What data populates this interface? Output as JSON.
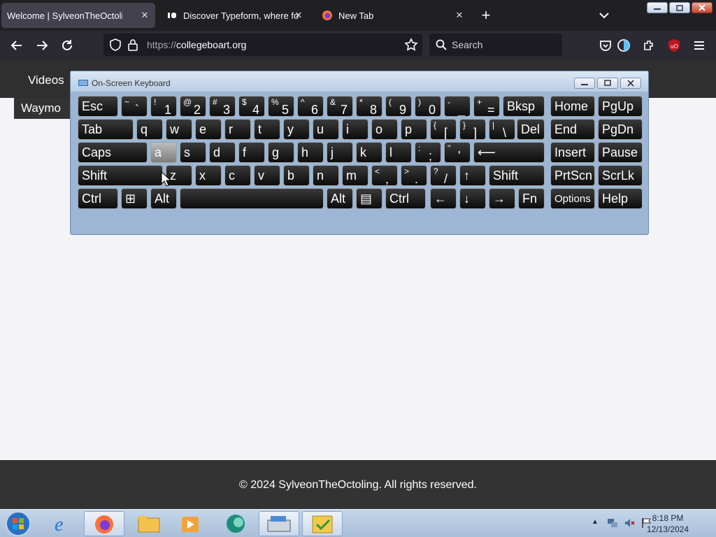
{
  "browser": {
    "tabs": [
      {
        "label": "Welcome | SylveonTheOctoling",
        "icon": "none",
        "active": true
      },
      {
        "label": "Discover Typeform, where form",
        "icon": "typeform-icon",
        "active": false
      },
      {
        "label": "New Tab",
        "icon": "firefox-icon",
        "active": false
      }
    ],
    "newtab_label": "+",
    "url_scheme": "https://",
    "url_host": "collegeboart.org",
    "search_placeholder": "Search"
  },
  "page": {
    "header_link": "Videos",
    "dropdown_item": "Waymo",
    "footer": "© 2024 SylveonTheOctoling. All rights reserved."
  },
  "osk": {
    "title": "On-Screen Keyboard",
    "pressed_key": "a",
    "rows": [
      [
        {
          "main": "Esc"
        },
        {
          "shift": "~",
          "base": "`"
        },
        {
          "shift": "!",
          "base": "1"
        },
        {
          "shift": "@",
          "base": "2"
        },
        {
          "shift": "#",
          "base": "3"
        },
        {
          "shift": "$",
          "base": "4"
        },
        {
          "shift": "%",
          "base": "5"
        },
        {
          "shift": "^",
          "base": "6"
        },
        {
          "shift": "&",
          "base": "7"
        },
        {
          "shift": "*",
          "base": "8"
        },
        {
          "shift": "(",
          "base": "9"
        },
        {
          "shift": ")",
          "base": "0"
        },
        {
          "shift": "-",
          "base": "_"
        },
        {
          "shift": "+",
          "base": "="
        },
        {
          "main": "Bksp"
        },
        {
          "main": "Home"
        },
        {
          "main": "PgUp"
        }
      ],
      [
        {
          "main": "Tab"
        },
        {
          "main": "q"
        },
        {
          "main": "w"
        },
        {
          "main": "e"
        },
        {
          "main": "r"
        },
        {
          "main": "t"
        },
        {
          "main": "y"
        },
        {
          "main": "u"
        },
        {
          "main": "i"
        },
        {
          "main": "o"
        },
        {
          "main": "p"
        },
        {
          "shift": "{",
          "base": "["
        },
        {
          "shift": "}",
          "base": "]"
        },
        {
          "shift": "|",
          "base": "\\"
        },
        {
          "main": "Del"
        },
        {
          "main": "End"
        },
        {
          "main": "PgDn"
        }
      ],
      [
        {
          "main": "Caps"
        },
        {
          "main": "a"
        },
        {
          "main": "s"
        },
        {
          "main": "d"
        },
        {
          "main": "f"
        },
        {
          "main": "g"
        },
        {
          "main": "h"
        },
        {
          "main": "j"
        },
        {
          "main": "k"
        },
        {
          "main": "l"
        },
        {
          "shift": ":",
          "base": ";"
        },
        {
          "shift": "\"",
          "base": "'"
        },
        {
          "main": "⟵"
        },
        {
          "main": "Insert"
        },
        {
          "main": "Pause"
        }
      ],
      [
        {
          "main": "Shift"
        },
        {
          "main": "z"
        },
        {
          "main": "x"
        },
        {
          "main": "c"
        },
        {
          "main": "v"
        },
        {
          "main": "b"
        },
        {
          "main": "n"
        },
        {
          "main": "m"
        },
        {
          "shift": "<",
          "base": ","
        },
        {
          "shift": ">",
          "base": "."
        },
        {
          "shift": "?",
          "base": "/"
        },
        {
          "main": "↑"
        },
        {
          "main": "Shift"
        },
        {
          "main": "PrtScn"
        },
        {
          "main": "ScrLk"
        }
      ],
      [
        {
          "main": "Ctrl"
        },
        {
          "main": "⊞"
        },
        {
          "main": "Alt"
        },
        {
          "main": ""
        },
        {
          "main": "Alt"
        },
        {
          "main": "▤"
        },
        {
          "main": "Ctrl"
        },
        {
          "main": "←"
        },
        {
          "main": "↓"
        },
        {
          "main": "→"
        },
        {
          "main": "Fn"
        },
        {
          "main": "Options"
        },
        {
          "main": "Help"
        }
      ]
    ]
  },
  "taskbar": {
    "apps": [
      "internet-explorer-icon",
      "firefox-icon",
      "file-explorer-icon",
      "media-player-icon",
      "teal-app-icon",
      "on-screen-keyboard-icon",
      "security-app-icon"
    ],
    "active_apps": [
      "firefox-icon",
      "on-screen-keyboard-icon",
      "security-app-icon"
    ],
    "time": "8:18 PM",
    "date": "12/13/2024"
  },
  "colors": {
    "tabbar": "#202023",
    "navbar": "#2b2a33",
    "accent_ublock": "#c0161e",
    "page_bg": "#f4f4f6",
    "footer": "#333333"
  }
}
